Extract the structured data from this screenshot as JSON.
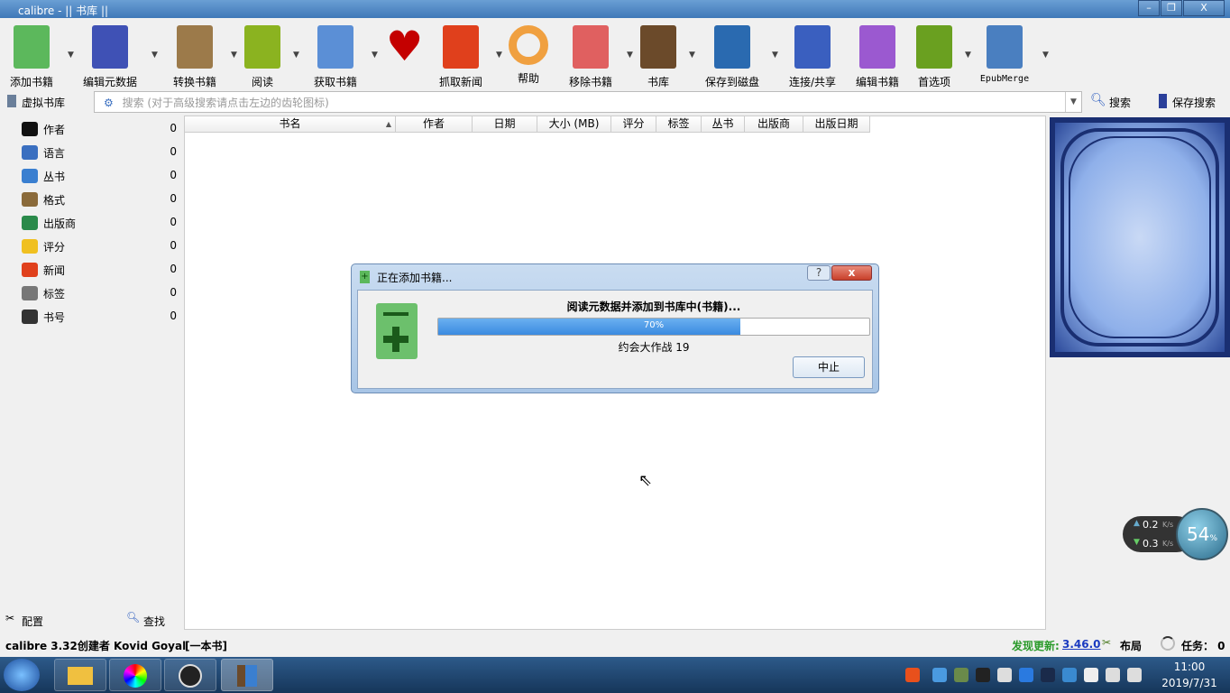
{
  "window": {
    "title": "calibre - || 书库 ||",
    "minimize": "–",
    "maximize": "❐",
    "close": "X"
  },
  "toolbar": {
    "items": [
      {
        "label": "添加书籍",
        "icon": "add-book-icon",
        "color": "#5cb85c"
      },
      {
        "label": "编辑元数据",
        "icon": "edit-metadata-icon",
        "color": "#3f51b5"
      },
      {
        "label": "转换书籍",
        "icon": "convert-book-icon",
        "color": "#9c7a4a"
      },
      {
        "label": "阅读",
        "icon": "read-book-icon",
        "color": "#8bb320"
      },
      {
        "label": "获取书籍",
        "icon": "get-books-icon",
        "color": "#5b8fd6"
      },
      {
        "label": "",
        "icon": "heart-icon",
        "color": "#c40000"
      },
      {
        "label": "抓取新闻",
        "icon": "fetch-news-icon",
        "color": "#e0401c"
      },
      {
        "label": "帮助",
        "icon": "help-lifebuoy-icon",
        "color": "#f0a040"
      },
      {
        "label": "移除书籍",
        "icon": "remove-book-icon",
        "color": "#e06060"
      },
      {
        "label": "书库",
        "icon": "library-icon",
        "color": "#6b4a2a"
      },
      {
        "label": "保存到磁盘",
        "icon": "save-disk-icon",
        "color": "#2a6ab0"
      },
      {
        "label": "连接/共享",
        "icon": "connect-share-icon",
        "color": "#3a5fbf"
      },
      {
        "label": "编辑书籍",
        "icon": "edit-book-icon",
        "color": "#9b59d0"
      },
      {
        "label": "首选项",
        "icon": "preferences-icon",
        "color": "#6aa020"
      },
      {
        "label": "EpubMerge",
        "icon": "epubmerge-icon",
        "color": "#4a7fc0"
      }
    ]
  },
  "searchbar": {
    "virtual_library": "虚拟书库",
    "placeholder": "搜索 (对于高级搜索请点击左边的齿轮图标)",
    "search": "搜索",
    "save_search": "保存搜索"
  },
  "categories": [
    {
      "name": "作者",
      "count": "0",
      "icon": "person-icon",
      "color": "#111"
    },
    {
      "name": "语言",
      "count": "0",
      "icon": "language-icon",
      "color": "#3a6fc0"
    },
    {
      "name": "丛书",
      "count": "0",
      "icon": "series-icon",
      "color": "#3a7fd0"
    },
    {
      "name": "格式",
      "count": "0",
      "icon": "format-icon",
      "color": "#8a6a3a"
    },
    {
      "name": "出版商",
      "count": "0",
      "icon": "publisher-icon",
      "color": "#2a8a4a"
    },
    {
      "name": "评分",
      "count": "0",
      "icon": "star-icon",
      "color": "#f0c020"
    },
    {
      "name": "新闻",
      "count": "0",
      "icon": "news-icon",
      "color": "#e0401c"
    },
    {
      "name": "标签",
      "count": "0",
      "icon": "tag-icon",
      "color": "#777"
    },
    {
      "name": "书号",
      "count": "0",
      "icon": "barcode-icon",
      "color": "#333"
    }
  ],
  "left_footer": {
    "configure": "配置",
    "find": "查找"
  },
  "columns": [
    "书名",
    "作者",
    "日期",
    "大小 (MB)",
    "评分",
    "标签",
    "丛书",
    "出版商",
    "出版日期"
  ],
  "sort_indicator": "▲",
  "dialog": {
    "title": "正在添加书籍...",
    "help": "?",
    "close": "x",
    "message": "阅读元数据并添加到书库中(书籍)...",
    "progress_percent": 70,
    "progress_label": "70%",
    "current_item": "约会大作战 19",
    "abort": "中止"
  },
  "netmonitor": {
    "up": "0.2",
    "down": "0.3",
    "unit": "K/s",
    "percent": "54",
    "percent_sign": "%"
  },
  "statusbar": {
    "left": "calibre 3.32创建者 Kovid Goyal",
    "book_count": "[一本书]",
    "update_label": "发现更新:",
    "update_version": "3.46.0",
    "layout": "布局",
    "jobs": "任务： 0"
  },
  "taskbar": {
    "time": "11:00",
    "date": "2019/7/31"
  }
}
